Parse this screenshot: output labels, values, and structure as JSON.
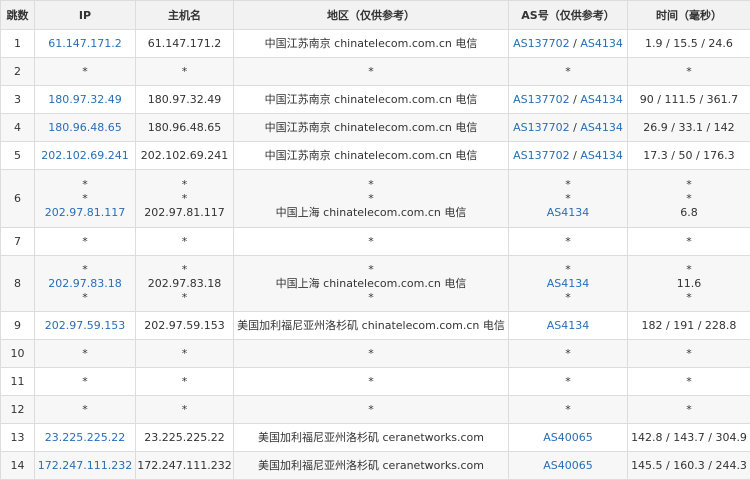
{
  "headers": [
    "跳数",
    "IP",
    "主机名",
    "地区（仅供参考）",
    "AS号（仅供参考）",
    "时间（毫秒）"
  ],
  "rows": [
    {
      "hop": "1",
      "ip": [
        "61.147.171.2"
      ],
      "host": [
        "61.147.171.2"
      ],
      "region": [
        "中国江苏南京 chinatelecom.com.cn 电信"
      ],
      "as": [
        [
          "AS137702",
          "AS4134"
        ]
      ],
      "time": [
        "1.9 / 15.5 / 24.6"
      ]
    },
    {
      "hop": "2",
      "ip": [
        "*"
      ],
      "host": [
        "*"
      ],
      "region": [
        "*"
      ],
      "as": [
        [
          "*"
        ]
      ],
      "time": [
        "*"
      ]
    },
    {
      "hop": "3",
      "ip": [
        "180.97.32.49"
      ],
      "host": [
        "180.97.32.49"
      ],
      "region": [
        "中国江苏南京 chinatelecom.com.cn 电信"
      ],
      "as": [
        [
          "AS137702",
          "AS4134"
        ]
      ],
      "time": [
        "90 / 111.5 / 361.7"
      ]
    },
    {
      "hop": "4",
      "ip": [
        "180.96.48.65"
      ],
      "host": [
        "180.96.48.65"
      ],
      "region": [
        "中国江苏南京 chinatelecom.com.cn 电信"
      ],
      "as": [
        [
          "AS137702",
          "AS4134"
        ]
      ],
      "time": [
        "26.9 / 33.1 / 142"
      ]
    },
    {
      "hop": "5",
      "ip": [
        "202.102.69.241"
      ],
      "host": [
        "202.102.69.241"
      ],
      "region": [
        "中国江苏南京 chinatelecom.com.cn 电信"
      ],
      "as": [
        [
          "AS137702",
          "AS4134"
        ]
      ],
      "time": [
        "17.3 / 50 / 176.3"
      ]
    },
    {
      "hop": "6",
      "ip": [
        "*",
        "*",
        "202.97.81.117"
      ],
      "host": [
        "*",
        "*",
        "202.97.81.117"
      ],
      "region": [
        "*",
        "*",
        "中国上海 chinatelecom.com.cn 电信"
      ],
      "as": [
        [
          "*"
        ],
        [
          "*"
        ],
        [
          "AS4134"
        ]
      ],
      "time": [
        "*",
        "*",
        "6.8"
      ]
    },
    {
      "hop": "7",
      "ip": [
        "*"
      ],
      "host": [
        "*"
      ],
      "region": [
        "*"
      ],
      "as": [
        [
          "*"
        ]
      ],
      "time": [
        "*"
      ]
    },
    {
      "hop": "8",
      "ip": [
        "*",
        "202.97.83.18",
        "*"
      ],
      "host": [
        "*",
        "202.97.83.18",
        "*"
      ],
      "region": [
        "*",
        "中国上海 chinatelecom.com.cn 电信",
        "*"
      ],
      "as": [
        [
          "*"
        ],
        [
          "AS4134"
        ],
        [
          "*"
        ]
      ],
      "time": [
        "*",
        "11.6",
        "*"
      ]
    },
    {
      "hop": "9",
      "ip": [
        "202.97.59.153"
      ],
      "host": [
        "202.97.59.153"
      ],
      "region": [
        "美国加利福尼亚州洛杉矶 chinatelecom.com.cn 电信"
      ],
      "as": [
        [
          "AS4134"
        ]
      ],
      "time": [
        "182 / 191 / 228.8"
      ]
    },
    {
      "hop": "10",
      "ip": [
        "*"
      ],
      "host": [
        "*"
      ],
      "region": [
        "*"
      ],
      "as": [
        [
          "*"
        ]
      ],
      "time": [
        "*"
      ]
    },
    {
      "hop": "11",
      "ip": [
        "*"
      ],
      "host": [
        "*"
      ],
      "region": [
        "*"
      ],
      "as": [
        [
          "*"
        ]
      ],
      "time": [
        "*"
      ]
    },
    {
      "hop": "12",
      "ip": [
        "*"
      ],
      "host": [
        "*"
      ],
      "region": [
        "*"
      ],
      "as": [
        [
          "*"
        ]
      ],
      "time": [
        "*"
      ]
    },
    {
      "hop": "13",
      "ip": [
        "23.225.225.22"
      ],
      "host": [
        "23.225.225.22"
      ],
      "region": [
        "美国加利福尼亚州洛杉矶 ceranetworks.com"
      ],
      "as": [
        [
          "AS40065"
        ]
      ],
      "time": [
        "142.8 / 143.7 / 304.9"
      ]
    },
    {
      "hop": "14",
      "ip": [
        "172.247.111.232"
      ],
      "host": [
        "172.247.111.232"
      ],
      "region": [
        "美国加利福尼亚州洛杉矶 ceranetworks.com"
      ],
      "as": [
        [
          "AS40065"
        ]
      ],
      "time": [
        "145.5 / 160.3 / 244.3"
      ]
    }
  ],
  "colors": {
    "link": "#2a6db5",
    "header_bg": "#f2f2f2",
    "stripe_bg": "#f7f7f7",
    "border": "#dcdcdc"
  }
}
